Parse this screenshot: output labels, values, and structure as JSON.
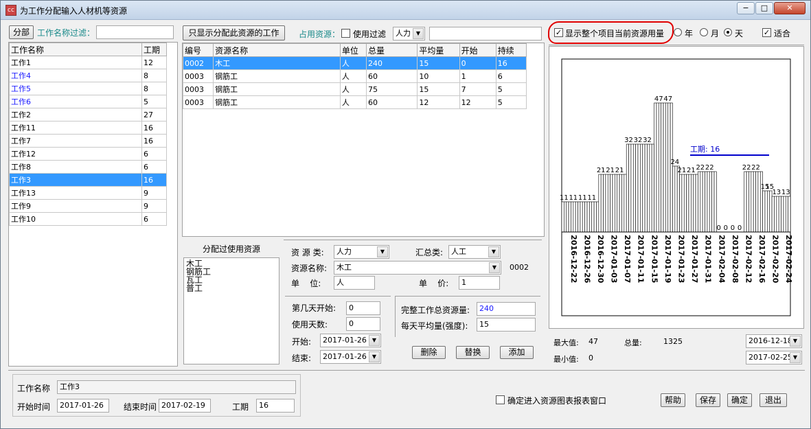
{
  "window": {
    "title": "为工作分配输入人材机等资源",
    "icon": "app-icon",
    "min": "−",
    "max": "□",
    "close": "✕"
  },
  "left": {
    "all_button": "分部",
    "filter_label": "工作名称过滤：",
    "filter_value": "",
    "columns": [
      "工作名称",
      "工期"
    ],
    "rows": [
      {
        "name": "工作1",
        "dur": "12",
        "blue": false,
        "sel": false
      },
      {
        "name": "工作4",
        "dur": "8",
        "blue": true,
        "sel": false
      },
      {
        "name": "工作5",
        "dur": "8",
        "blue": true,
        "sel": false
      },
      {
        "name": "工作6",
        "dur": "5",
        "blue": true,
        "sel": false
      },
      {
        "name": "工作2",
        "dur": "27",
        "blue": false,
        "sel": false
      },
      {
        "name": "工作11",
        "dur": "16",
        "blue": false,
        "sel": false
      },
      {
        "name": "工作7",
        "dur": "16",
        "blue": false,
        "sel": false
      },
      {
        "name": "工作12",
        "dur": "6",
        "blue": false,
        "sel": false
      },
      {
        "name": "工作8",
        "dur": "6",
        "blue": false,
        "sel": false
      },
      {
        "name": "工作3",
        "dur": "16",
        "blue": false,
        "sel": true
      },
      {
        "name": "工作13",
        "dur": "9",
        "blue": false,
        "sel": false
      },
      {
        "name": "工作9",
        "dur": "9",
        "blue": false,
        "sel": false
      },
      {
        "name": "工作10",
        "dur": "6",
        "blue": false,
        "sel": false
      }
    ]
  },
  "middle": {
    "only_button": "只显示分配此资源的工作",
    "occupy_label": "占用资源：",
    "use_filter_label": "使用过滤",
    "filter_type": "人力",
    "filter_text": "",
    "columns": [
      "编号",
      "资源名称",
      "单位",
      "总量",
      "平均量",
      "开始",
      "持续"
    ],
    "rows": [
      {
        "cells": [
          "0002",
          "木工",
          "人",
          "240",
          "15",
          "0",
          "16"
        ],
        "sel": true
      },
      {
        "cells": [
          "0003",
          "钢筋工",
          "人",
          "60",
          "10",
          "1",
          "6"
        ],
        "sel": false
      },
      {
        "cells": [
          "0003",
          "钢筋工",
          "人",
          "75",
          "15",
          "7",
          "5"
        ],
        "sel": false
      },
      {
        "cells": [
          "0003",
          "钢筋工",
          "人",
          "60",
          "12",
          "12",
          "5"
        ],
        "sel": false
      }
    ],
    "assigned_title": "分配过使用资源",
    "assigned_items": [
      "木工",
      "钢筋工",
      "瓦工",
      "普工"
    ]
  },
  "form": {
    "res_type_label": "资 源 类:",
    "res_type_value": "人力",
    "summary_label": "汇总类:",
    "summary_value": "人工",
    "res_name_label": "资源名称:",
    "res_name_value": "木工",
    "res_code": "0002",
    "unit_label": "单    位:",
    "unit_value": "人",
    "price_label": "单    价:",
    "price_value": "1",
    "start_day_label": "第几天开始:",
    "start_day_value": "0",
    "use_days_label": "使用天数:",
    "use_days_value": "0",
    "start_label": "开始:",
    "start_value": "2017-01-26",
    "end_label": "结束:",
    "end_value": "2017-01-26",
    "total_label": "完整工作总资源量:",
    "total_value": "240",
    "daily_label": "每天平均量(强度):",
    "daily_value": "15",
    "delete_button": "删除",
    "replace_button": "替换",
    "add_button": "添加"
  },
  "chart_panel": {
    "show_all_label": "显示整个项目当前资源用量",
    "show_all_checked": true,
    "year_label": "年",
    "month_label": "月",
    "day_label": "天",
    "fit_label": "适合",
    "fit_checked": true,
    "max_label": "最大值:",
    "max_value": "47",
    "total_label": "总量:",
    "total_value": "1325",
    "min_label": "最小值:",
    "min_value": "0",
    "from_date": "2016-12-18",
    "to_date": "2017-02-25",
    "highlight_color": "#e00000"
  },
  "chart_data": {
    "type": "bar",
    "values": [
      11,
      11,
      11,
      11,
      11,
      11,
      11,
      11,
      11,
      11,
      11,
      11,
      11,
      11,
      11,
      11,
      21,
      21,
      21,
      21,
      21,
      21,
      21,
      21,
      21,
      21,
      21,
      21,
      32,
      32,
      32,
      32,
      32,
      32,
      32,
      32,
      32,
      32,
      32,
      32,
      47,
      47,
      47,
      47,
      47,
      47,
      47,
      47,
      24,
      24,
      24,
      21,
      21,
      21,
      21,
      21,
      21,
      21,
      21,
      22,
      22,
      22,
      22,
      22,
      22,
      22,
      22,
      0,
      0,
      0,
      0,
      0,
      0,
      0,
      0,
      0,
      0,
      0,
      0,
      22,
      22,
      22,
      22,
      22,
      22,
      22,
      22,
      15,
      15,
      15,
      15,
      13,
      13,
      13,
      13,
      13,
      13,
      13,
      13
    ],
    "value_labels": [
      {
        "text": "11",
        "index": 1
      },
      {
        "text": "11",
        "index": 5
      },
      {
        "text": "11",
        "index": 9
      },
      {
        "text": "11",
        "index": 13
      },
      {
        "text": "21",
        "index": 17
      },
      {
        "text": "21",
        "index": 21
      },
      {
        "text": "21",
        "index": 25
      },
      {
        "text": "32",
        "index": 29
      },
      {
        "text": "32",
        "index": 33
      },
      {
        "text": "32",
        "index": 37
      },
      {
        "text": "47",
        "index": 42
      },
      {
        "text": "47",
        "index": 46
      },
      {
        "text": "24",
        "index": 49
      },
      {
        "text": "21",
        "index": 52
      },
      {
        "text": "21",
        "index": 56
      },
      {
        "text": "22",
        "index": 60
      },
      {
        "text": "22",
        "index": 64
      },
      {
        "text": "0",
        "index": 68
      },
      {
        "text": "0",
        "index": 71
      },
      {
        "text": "0",
        "index": 74
      },
      {
        "text": "0",
        "index": 77
      },
      {
        "text": "22",
        "index": 80
      },
      {
        "text": "22",
        "index": 84
      },
      {
        "text": "15",
        "index": 88
      },
      {
        "text": "15",
        "index": 90
      },
      {
        "text": "13",
        "index": 93
      },
      {
        "text": "13",
        "index": 97
      }
    ],
    "x_labels": [
      "2016-12-22",
      "2016-12-26",
      "2016-12-30",
      "2017-01-03",
      "2017-01-07",
      "2017-01-11",
      "2017-01-15",
      "2017-01-19",
      "2017-01-23",
      "2017-01-27",
      "2017-01-31",
      "2017-02-04",
      "2017-02-08",
      "2017-02-12",
      "2017-02-16",
      "2017-02-20",
      "2017-02-24"
    ],
    "annotation": "工期: 16",
    "annotation_color": "#0000cc",
    "bar_color": "#ffffff",
    "bar_edge": "#000000",
    "ylim": [
      0,
      60
    ]
  },
  "bottom": {
    "name_label": "工作名称",
    "name_value": "工作3",
    "start_label": "开始时间",
    "start_value": "2017-01-26",
    "end_label": "结束时间",
    "end_value": "2017-02-19",
    "dur_label": "工期",
    "dur_value": "16",
    "report_label": "确定进入资源图表报表窗口",
    "help_button": "帮助",
    "save_button": "保存",
    "ok_button": "确定",
    "exit_button": "退出"
  }
}
